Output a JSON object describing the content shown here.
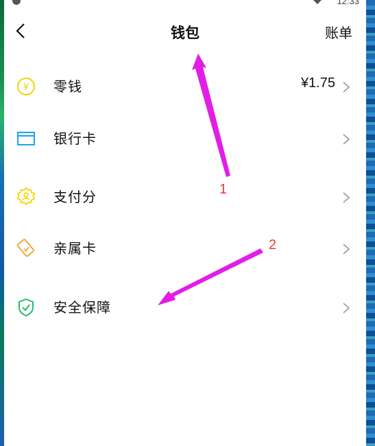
{
  "status": {
    "time": "12:33"
  },
  "header": {
    "title": "钱包",
    "bill_label": "账单"
  },
  "menu": {
    "items": [
      {
        "label": "零钱",
        "value": "¥1.75"
      },
      {
        "label": "银行卡",
        "value": ""
      },
      {
        "label": "支付分",
        "value": ""
      },
      {
        "label": "亲属卡",
        "value": ""
      },
      {
        "label": "安全保障",
        "value": ""
      }
    ]
  },
  "annotations": {
    "label_1": "1",
    "label_2": "2"
  },
  "colors": {
    "change_icon": "#f2d600",
    "bank_icon": "#1aa3e8",
    "score_icon": "#f2d600",
    "family_icon": "#f0a030",
    "security_icon": "#1fbf6a",
    "arrow": "#e21ee6",
    "annotation_number": "#e83a3a"
  }
}
